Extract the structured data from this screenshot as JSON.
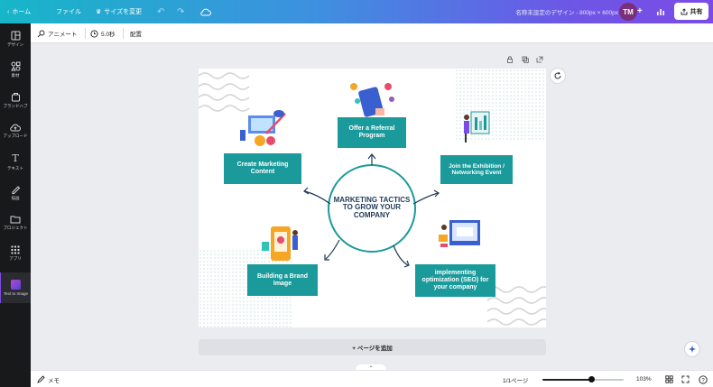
{
  "topbar": {
    "home_label": "ホーム",
    "file_label": "ファイル",
    "resize_label": "サイズを変更",
    "doc_title": "名称未設定のデザイン - 800px × 600px",
    "avatar_initials": "TM",
    "add_label": "+",
    "share_label": "共有"
  },
  "sidebar": {
    "items": [
      {
        "label": "デザイン",
        "icon": "layout-icon"
      },
      {
        "label": "素材",
        "icon": "shapes-icon"
      },
      {
        "label": "ブランドハブ",
        "icon": "brand-icon"
      },
      {
        "label": "アップロード",
        "icon": "upload-icon"
      },
      {
        "label": "テキスト",
        "icon": "text-icon"
      },
      {
        "label": "描画",
        "icon": "draw-icon"
      },
      {
        "label": "プロジェクト",
        "icon": "folder-icon"
      },
      {
        "label": "アプリ",
        "icon": "apps-icon"
      },
      {
        "label": "Text to Image",
        "icon": "text-to-image-icon"
      }
    ]
  },
  "toolbar2": {
    "animate_label": "アニメート",
    "duration_label": "5.0秒",
    "position_label": "配置"
  },
  "design": {
    "center_title": "MARKETING TACTICS TO GROW YOUR COMPANY",
    "boxes": {
      "referral": "Offer a Referral Program",
      "content": "Create Marketing Content",
      "exhibition": "Join the Exhibition / Networking Event",
      "brand": "Building a Brand Image",
      "seo": "implementing optimization (SEO) for your company"
    },
    "accent_color": "#1b9a9b",
    "title_color": "#1f3b5a"
  },
  "add_page_label": "+ ページを追加",
  "bottombar": {
    "notes_label": "メモ",
    "page_indicator": "1/1ページ",
    "zoom_label": "103%",
    "zoom_fraction": 0.6
  }
}
